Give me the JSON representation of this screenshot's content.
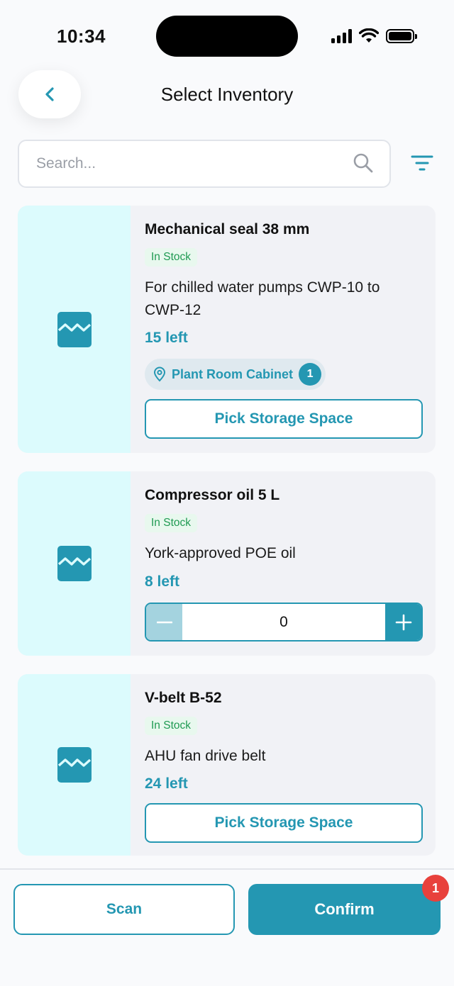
{
  "status_bar": {
    "time": "10:34"
  },
  "header": {
    "title": "Select Inventory"
  },
  "search": {
    "placeholder": "Search..."
  },
  "items": [
    {
      "name": "Mechanical seal 38 mm",
      "stock_status": "In Stock",
      "description": "For chilled water pumps CWP-10 to CWP-12",
      "quantity_left": "15 left",
      "location": {
        "label": "Plant Room Cabinet",
        "count": "1"
      },
      "action_label": "Pick Storage Space"
    },
    {
      "name": "Compressor oil 5 L",
      "stock_status": "In Stock",
      "description": "York-approved POE oil",
      "quantity_left": "8 left",
      "stepper_value": "0"
    },
    {
      "name": "V-belt B-52",
      "stock_status": "In Stock",
      "description": "AHU fan drive belt",
      "quantity_left": "24 left",
      "action_label": "Pick Storage Space"
    }
  ],
  "bottom_bar": {
    "scan_label": "Scan",
    "confirm_label": "Confirm",
    "confirm_badge": "1"
  },
  "colors": {
    "accent": "#2497b2",
    "thumb_bg": "#dcfbfd",
    "in_stock_text": "#1f9a52",
    "badge_red": "#e8413c"
  },
  "icons": [
    "back-chevron-icon",
    "search-icon",
    "filter-icon",
    "image-placeholder-icon",
    "location-pin-icon",
    "minus-icon",
    "plus-icon",
    "wifi-icon",
    "signal-icon",
    "battery-icon"
  ]
}
